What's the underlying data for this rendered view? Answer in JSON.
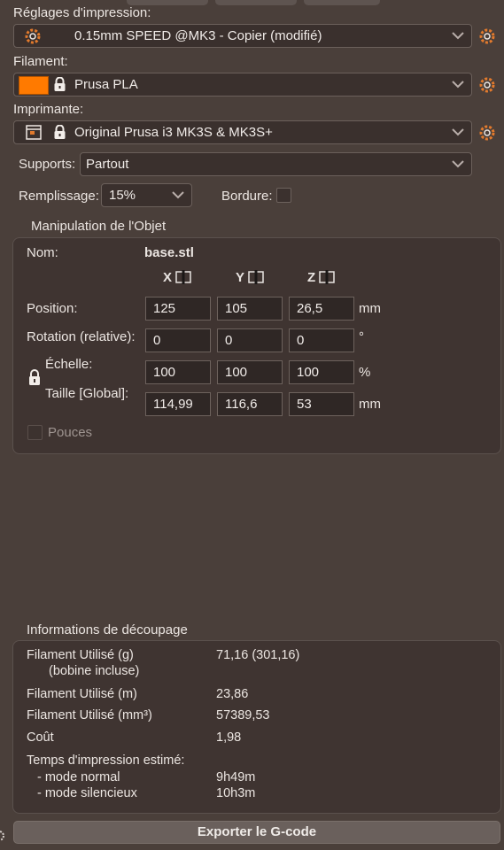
{
  "print_settings": {
    "label": "Réglages d'impression:",
    "value": "0.15mm SPEED @MK3 - Copier (modifié)"
  },
  "filament": {
    "label": "Filament:",
    "value": "Prusa PLA",
    "color": "#ff7a00"
  },
  "printer": {
    "label": "Imprimante:",
    "value": "Original Prusa i3 MK3S & MK3S+"
  },
  "supports": {
    "label": "Supports:",
    "value": "Partout"
  },
  "infill": {
    "label": "Remplissage:",
    "value": "15%"
  },
  "brim": {
    "label": "Bordure:"
  },
  "object_manipulation": {
    "title": "Manipulation de l'Objet",
    "name_label": "Nom:",
    "name_value": "base.stl",
    "axes": [
      "X",
      "Y",
      "Z"
    ],
    "position": {
      "label": "Position:",
      "values": [
        "125",
        "105",
        "26,5"
      ],
      "unit": "mm"
    },
    "rotation": {
      "label": "Rotation (relative):",
      "values": [
        "0",
        "0",
        "0"
      ],
      "unit": "°"
    },
    "scale": {
      "label": "Échelle:",
      "values": [
        "100",
        "100",
        "100"
      ],
      "unit": "%"
    },
    "size": {
      "label": "Taille [Global]:",
      "values": [
        "114,99",
        "116,6",
        "53"
      ],
      "unit": "mm"
    },
    "inches_label": "Pouces"
  },
  "slicing_info": {
    "title": "Informations de découpage",
    "filament_g_label": "Filament Utilisé (g)",
    "filament_g_sub": "(bobine incluse)",
    "filament_g_value": "71,16 (301,16)",
    "filament_m_label": "Filament Utilisé (m)",
    "filament_m_value": "23,86",
    "filament_mm3_label": "Filament Utilisé (mm³)",
    "filament_mm3_value": "57389,53",
    "cost_label": "Coût",
    "cost_value": "1,98",
    "time_label": "Temps d'impression estimé:",
    "normal_label": "- mode normal",
    "normal_value": "9h49m",
    "silent_label": "- mode silencieux",
    "silent_value": "10h3m"
  },
  "export_label": "Exporter le G-code",
  "colors": {
    "accent_orange": "#ff7a00",
    "background": "#4a3f3a"
  }
}
